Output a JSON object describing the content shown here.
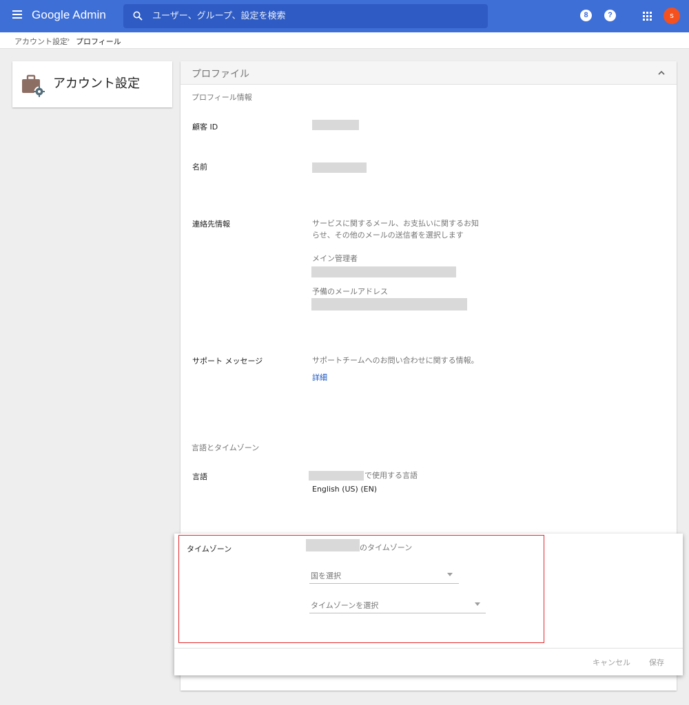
{
  "topbar": {
    "logo": "Google Admin",
    "search_placeholder": "ユーザー、グループ、設定を検索",
    "notifications_badge": "8",
    "help_label": "?",
    "avatar_initial": "s",
    "colors": {
      "bar": "#3e6fd7",
      "search": "#2f5cc4",
      "avatar": "#f4511e"
    }
  },
  "breadcrumb": {
    "parent": "アカウント設定",
    "separator": "›",
    "current": "プロフィール"
  },
  "left_card": {
    "title": "アカウント設定",
    "icon": "briefcase-gear-icon"
  },
  "profile_card": {
    "header": "プロファイル",
    "section_profile": "プロフィール情報",
    "customer_id_label": "顧客 ID",
    "name_label": "名前",
    "contact_label": "連絡先情報",
    "contact_desc_line1": "サービスに関するメール、お支払いに関するお知",
    "contact_desc_line2": "らせ、その他のメールの送信者を選択します",
    "main_admin_label": "メイン管理者",
    "backup_email_label": "予備のメールアドレス",
    "support_label": "サポート メッセージ",
    "support_desc": "サポートチームへのお問い合わせに関する情報。",
    "support_link": "詳細",
    "section_lang_tz": "言語とタイムゾーン",
    "language_label": "言語",
    "language_suffix": "で使用する言語",
    "language_value": "English (US) (EN)"
  },
  "timezone_panel": {
    "label": "タイムゾーン",
    "suffix": "のタイムゾーン",
    "country_placeholder": "国を選択",
    "timezone_placeholder": "タイムゾーンを選択",
    "cancel": "キャンセル",
    "save": "保存",
    "highlight_color": "#e3262a"
  }
}
